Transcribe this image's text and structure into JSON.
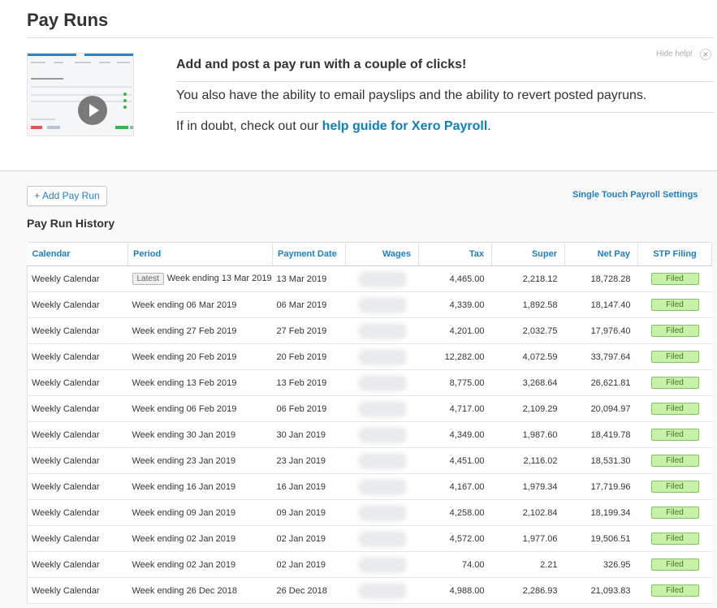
{
  "page_title": "Pay Runs",
  "help": {
    "heading": "Add and post a pay run with a couple of clicks!",
    "line2": "You also have the ability to email payslips and the ability to revert posted payruns.",
    "line3_prefix": "If in doubt, check out our ",
    "line3_link": "help guide for Xero Payroll",
    "line3_suffix": ".",
    "hide_label": "Hide help!",
    "close_glyph": "✕"
  },
  "toolbar": {
    "add_button": "+ Add Pay Run",
    "stp_settings_link": "Single Touch Payroll Settings"
  },
  "history_title": "Pay Run History",
  "table": {
    "headers": [
      "Calendar",
      "Period",
      "Payment Date",
      "Wages",
      "Tax",
      "Super",
      "Net Pay",
      "STP Filing"
    ],
    "latest_badge": "Latest",
    "rows": [
      {
        "calendar": "Weekly Calendar",
        "period": "Week ending 13 Mar 2019",
        "payment_date": "13 Mar 2019",
        "tax": "4,465.00",
        "super": "2,218.12",
        "net_pay": "18,728.28",
        "stp": "Filed"
      },
      {
        "calendar": "Weekly Calendar",
        "period": "Week ending 06 Mar 2019",
        "payment_date": "06 Mar 2019",
        "tax": "4,339.00",
        "super": "1,892.58",
        "net_pay": "18,147.40",
        "stp": "Filed"
      },
      {
        "calendar": "Weekly Calendar",
        "period": "Week ending 27 Feb 2019",
        "payment_date": "27 Feb 2019",
        "tax": "4,201.00",
        "super": "2,032.75",
        "net_pay": "17,976.40",
        "stp": "Filed"
      },
      {
        "calendar": "Weekly Calendar",
        "period": "Week ending 20 Feb 2019",
        "payment_date": "20 Feb 2019",
        "tax": "12,282.00",
        "super": "4,072.59",
        "net_pay": "33,797.64",
        "stp": "Filed"
      },
      {
        "calendar": "Weekly Calendar",
        "period": "Week ending 13 Feb 2019",
        "payment_date": "13 Feb 2019",
        "tax": "8,775.00",
        "super": "3,268.64",
        "net_pay": "26,621.81",
        "stp": "Filed"
      },
      {
        "calendar": "Weekly Calendar",
        "period": "Week ending 06 Feb 2019",
        "payment_date": "06 Feb 2019",
        "tax": "4,717.00",
        "super": "2,109.29",
        "net_pay": "20,094.97",
        "stp": "Filed"
      },
      {
        "calendar": "Weekly Calendar",
        "period": "Week ending 30 Jan 2019",
        "payment_date": "30 Jan 2019",
        "tax": "4,349.00",
        "super": "1,987.60",
        "net_pay": "18,419.78",
        "stp": "Filed"
      },
      {
        "calendar": "Weekly Calendar",
        "period": "Week ending 23 Jan 2019",
        "payment_date": "23 Jan 2019",
        "tax": "4,451.00",
        "super": "2,116.02",
        "net_pay": "18,531.30",
        "stp": "Filed"
      },
      {
        "calendar": "Weekly Calendar",
        "period": "Week ending 16 Jan 2019",
        "payment_date": "16 Jan 2019",
        "tax": "4,167.00",
        "super": "1,979.34",
        "net_pay": "17,719.96",
        "stp": "Filed"
      },
      {
        "calendar": "Weekly Calendar",
        "period": "Week ending 09 Jan 2019",
        "payment_date": "09 Jan 2019",
        "tax": "4,258.00",
        "super": "2,102.84",
        "net_pay": "18,199.34",
        "stp": "Filed"
      },
      {
        "calendar": "Weekly Calendar",
        "period": "Week ending 02 Jan 2019",
        "payment_date": "02 Jan 2019",
        "tax": "4,572.00",
        "super": "1,977.06",
        "net_pay": "19,506.51",
        "stp": "Filed"
      },
      {
        "calendar": "Weekly Calendar",
        "period": "Week ending 02 Jan 2019",
        "payment_date": "02 Jan 2019",
        "tax": "74.00",
        "super": "2.21",
        "net_pay": "326.95",
        "stp": "Filed"
      },
      {
        "calendar": "Weekly Calendar",
        "period": "Week ending 26 Dec 2018",
        "payment_date": "26 Dec 2018",
        "tax": "4,988.00",
        "super": "2,286.93",
        "net_pay": "21,093.83",
        "stp": "Filed"
      }
    ]
  },
  "colors": {
    "link": "#1f7ec2",
    "filed_bg": "#c8f0a8",
    "filed_border": "#7bc85a"
  }
}
